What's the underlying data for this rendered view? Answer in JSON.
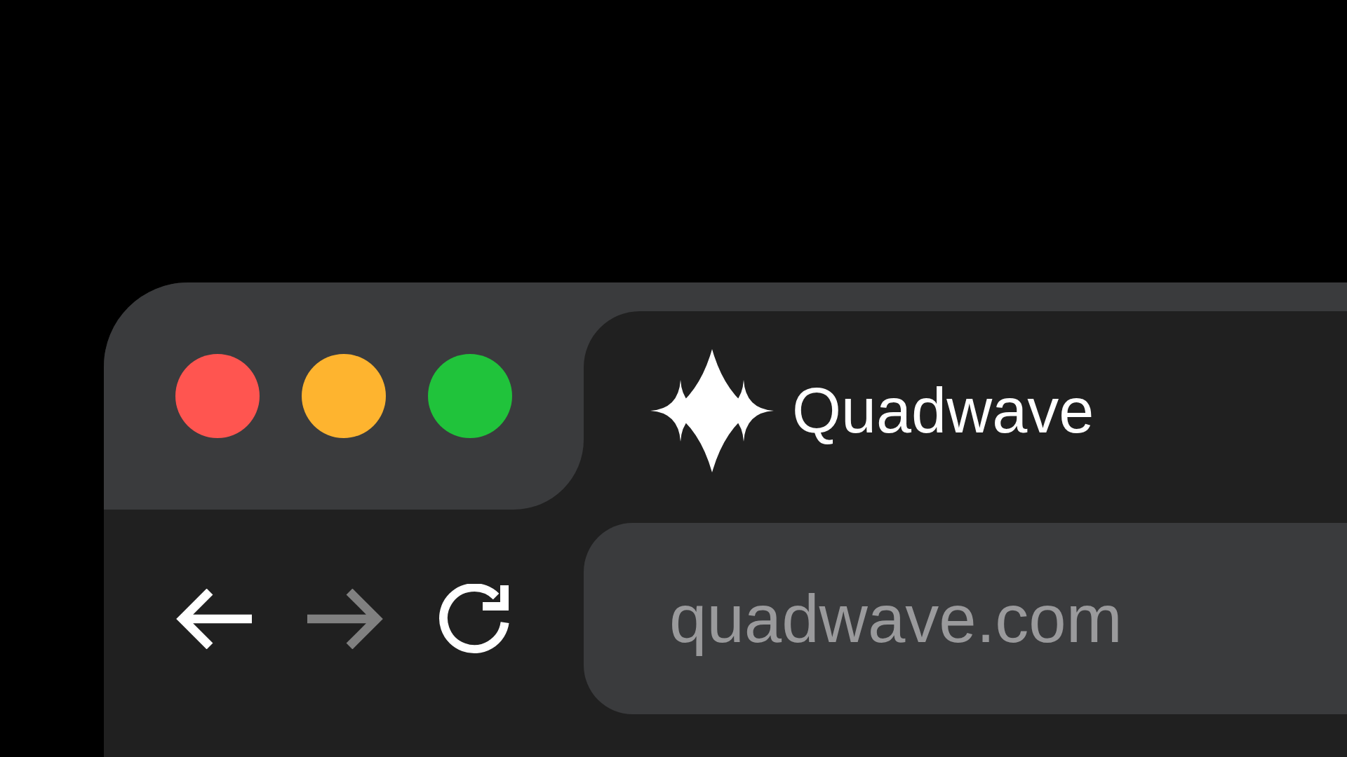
{
  "window_controls": [
    {
      "color": "#ff5550"
    },
    {
      "color": "#feb42f"
    },
    {
      "color": "#20c33b"
    }
  ],
  "tab": {
    "title": "Quadwave"
  },
  "toolbar": {
    "buttons": [
      {
        "kind": "back",
        "disabled": false
      },
      {
        "kind": "forward",
        "disabled": true
      },
      {
        "kind": "reload",
        "disabled": false
      }
    ]
  },
  "address_bar": {
    "value": "quadwave.com"
  }
}
